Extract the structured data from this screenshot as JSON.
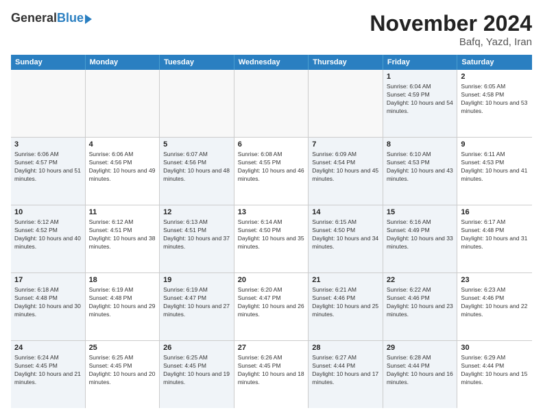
{
  "logo": {
    "general": "General",
    "blue": "Blue"
  },
  "header": {
    "title": "November 2024",
    "subtitle": "Bafq, Yazd, Iran"
  },
  "weekdays": [
    "Sunday",
    "Monday",
    "Tuesday",
    "Wednesday",
    "Thursday",
    "Friday",
    "Saturday"
  ],
  "rows": [
    [
      {
        "day": "",
        "text": "",
        "empty": true
      },
      {
        "day": "",
        "text": "",
        "empty": true
      },
      {
        "day": "",
        "text": "",
        "empty": true
      },
      {
        "day": "",
        "text": "",
        "empty": true
      },
      {
        "day": "",
        "text": "",
        "empty": true
      },
      {
        "day": "1",
        "text": "Sunrise: 6:04 AM\nSunset: 4:59 PM\nDaylight: 10 hours and 54 minutes.",
        "shade": true
      },
      {
        "day": "2",
        "text": "Sunrise: 6:05 AM\nSunset: 4:58 PM\nDaylight: 10 hours and 53 minutes.",
        "shade": false
      }
    ],
    [
      {
        "day": "3",
        "text": "Sunrise: 6:06 AM\nSunset: 4:57 PM\nDaylight: 10 hours and 51 minutes.",
        "shade": true
      },
      {
        "day": "4",
        "text": "Sunrise: 6:06 AM\nSunset: 4:56 PM\nDaylight: 10 hours and 49 minutes.",
        "shade": false
      },
      {
        "day": "5",
        "text": "Sunrise: 6:07 AM\nSunset: 4:56 PM\nDaylight: 10 hours and 48 minutes.",
        "shade": true
      },
      {
        "day": "6",
        "text": "Sunrise: 6:08 AM\nSunset: 4:55 PM\nDaylight: 10 hours and 46 minutes.",
        "shade": false
      },
      {
        "day": "7",
        "text": "Sunrise: 6:09 AM\nSunset: 4:54 PM\nDaylight: 10 hours and 45 minutes.",
        "shade": true
      },
      {
        "day": "8",
        "text": "Sunrise: 6:10 AM\nSunset: 4:53 PM\nDaylight: 10 hours and 43 minutes.",
        "shade": true
      },
      {
        "day": "9",
        "text": "Sunrise: 6:11 AM\nSunset: 4:53 PM\nDaylight: 10 hours and 41 minutes.",
        "shade": false
      }
    ],
    [
      {
        "day": "10",
        "text": "Sunrise: 6:12 AM\nSunset: 4:52 PM\nDaylight: 10 hours and 40 minutes.",
        "shade": true
      },
      {
        "day": "11",
        "text": "Sunrise: 6:12 AM\nSunset: 4:51 PM\nDaylight: 10 hours and 38 minutes.",
        "shade": false
      },
      {
        "day": "12",
        "text": "Sunrise: 6:13 AM\nSunset: 4:51 PM\nDaylight: 10 hours and 37 minutes.",
        "shade": true
      },
      {
        "day": "13",
        "text": "Sunrise: 6:14 AM\nSunset: 4:50 PM\nDaylight: 10 hours and 35 minutes.",
        "shade": false
      },
      {
        "day": "14",
        "text": "Sunrise: 6:15 AM\nSunset: 4:50 PM\nDaylight: 10 hours and 34 minutes.",
        "shade": true
      },
      {
        "day": "15",
        "text": "Sunrise: 6:16 AM\nSunset: 4:49 PM\nDaylight: 10 hours and 33 minutes.",
        "shade": true
      },
      {
        "day": "16",
        "text": "Sunrise: 6:17 AM\nSunset: 4:48 PM\nDaylight: 10 hours and 31 minutes.",
        "shade": false
      }
    ],
    [
      {
        "day": "17",
        "text": "Sunrise: 6:18 AM\nSunset: 4:48 PM\nDaylight: 10 hours and 30 minutes.",
        "shade": true
      },
      {
        "day": "18",
        "text": "Sunrise: 6:19 AM\nSunset: 4:48 PM\nDaylight: 10 hours and 29 minutes.",
        "shade": false
      },
      {
        "day": "19",
        "text": "Sunrise: 6:19 AM\nSunset: 4:47 PM\nDaylight: 10 hours and 27 minutes.",
        "shade": true
      },
      {
        "day": "20",
        "text": "Sunrise: 6:20 AM\nSunset: 4:47 PM\nDaylight: 10 hours and 26 minutes.",
        "shade": false
      },
      {
        "day": "21",
        "text": "Sunrise: 6:21 AM\nSunset: 4:46 PM\nDaylight: 10 hours and 25 minutes.",
        "shade": true
      },
      {
        "day": "22",
        "text": "Sunrise: 6:22 AM\nSunset: 4:46 PM\nDaylight: 10 hours and 23 minutes.",
        "shade": true
      },
      {
        "day": "23",
        "text": "Sunrise: 6:23 AM\nSunset: 4:46 PM\nDaylight: 10 hours and 22 minutes.",
        "shade": false
      }
    ],
    [
      {
        "day": "24",
        "text": "Sunrise: 6:24 AM\nSunset: 4:45 PM\nDaylight: 10 hours and 21 minutes.",
        "shade": true
      },
      {
        "day": "25",
        "text": "Sunrise: 6:25 AM\nSunset: 4:45 PM\nDaylight: 10 hours and 20 minutes.",
        "shade": false
      },
      {
        "day": "26",
        "text": "Sunrise: 6:25 AM\nSunset: 4:45 PM\nDaylight: 10 hours and 19 minutes.",
        "shade": true
      },
      {
        "day": "27",
        "text": "Sunrise: 6:26 AM\nSunset: 4:45 PM\nDaylight: 10 hours and 18 minutes.",
        "shade": false
      },
      {
        "day": "28",
        "text": "Sunrise: 6:27 AM\nSunset: 4:44 PM\nDaylight: 10 hours and 17 minutes.",
        "shade": true
      },
      {
        "day": "29",
        "text": "Sunrise: 6:28 AM\nSunset: 4:44 PM\nDaylight: 10 hours and 16 minutes.",
        "shade": true
      },
      {
        "day": "30",
        "text": "Sunrise: 6:29 AM\nSunset: 4:44 PM\nDaylight: 10 hours and 15 minutes.",
        "shade": false
      }
    ]
  ]
}
